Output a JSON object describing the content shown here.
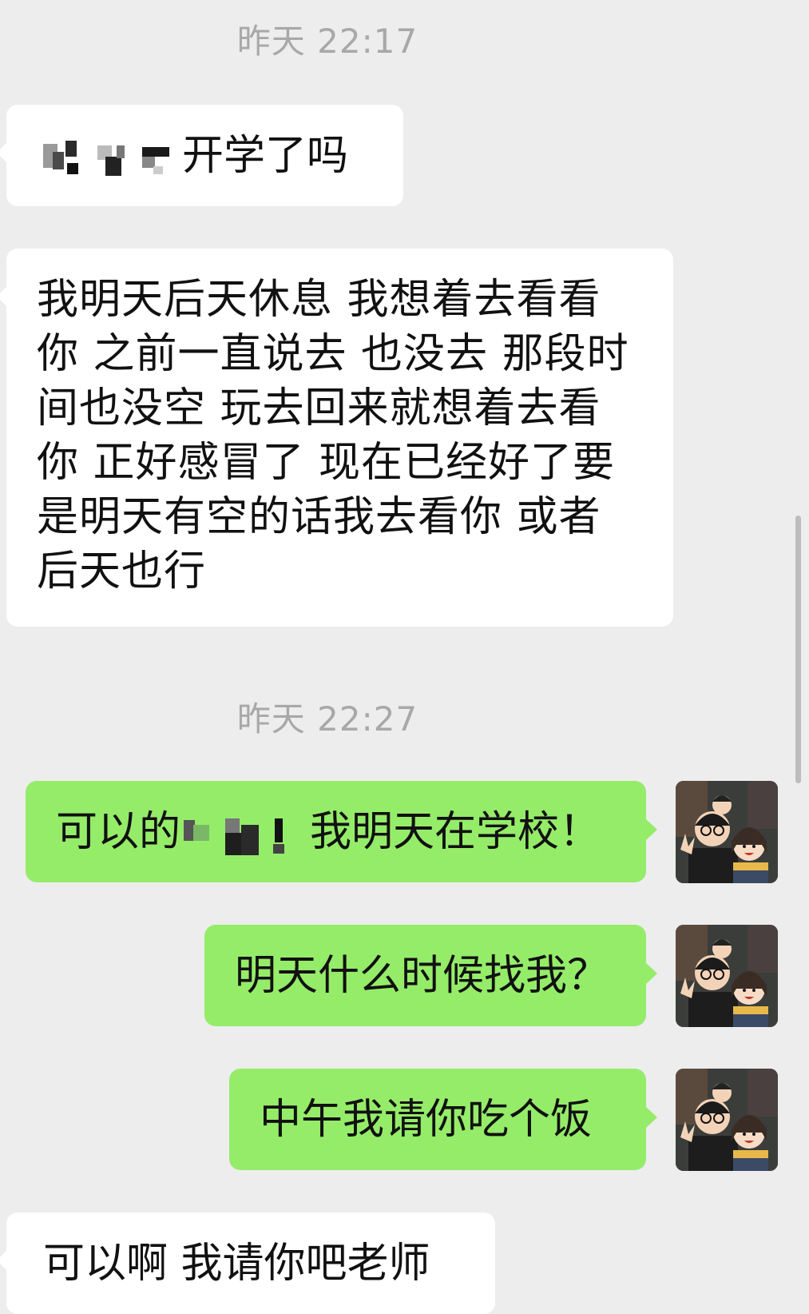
{
  "chat": {
    "timestamps": [
      "昨天 22:17",
      "昨天 22:27"
    ],
    "messages": [
      {
        "side": "received",
        "text": "开学了吗",
        "redacted_prefix": true
      },
      {
        "side": "received",
        "text": "我明天后天休息 我想着去看看你 之前一直说去 也没去 那段时间也没空 玩去回来就想着去看你 正好感冒了 现在已经好了要是明天有空的话我去看你 或者后天也行"
      },
      {
        "side": "sent",
        "text_before": "可以的",
        "text_after": "我明天在学校！",
        "redacted_middle": true
      },
      {
        "side": "sent",
        "text": "明天什么时候找我？"
      },
      {
        "side": "sent",
        "text": "中午我请你吃个饭"
      },
      {
        "side": "received",
        "text": "可以啊 我请你吧老师"
      }
    ],
    "avatar_icon": "cartoon-couple-avatar-icon"
  },
  "colors": {
    "background": "#EDEDED",
    "received_bubble": "#FFFFFF",
    "sent_bubble": "#95EC69",
    "timestamp": "#A8A8A8"
  }
}
